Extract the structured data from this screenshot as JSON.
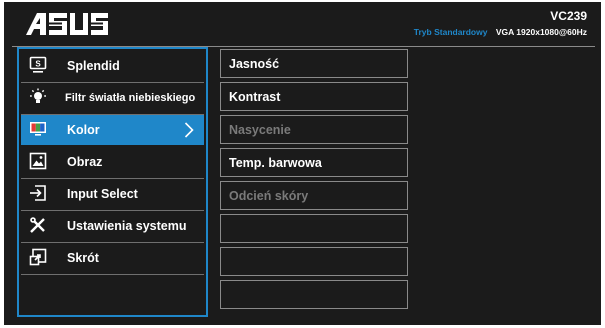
{
  "header": {
    "brand": "ASUS",
    "model": "VC239",
    "mode": "Tryb Standardowy",
    "signal": "VGA  1920x1080@60Hz"
  },
  "main_menu": [
    {
      "label": "Splendid",
      "icon": "splendid-icon",
      "active": false
    },
    {
      "label": "Filtr światła niebieskiego",
      "icon": "bluelight-bulb-icon",
      "active": false
    },
    {
      "label": "Kolor",
      "icon": "color-icon",
      "active": true
    },
    {
      "label": "Obraz",
      "icon": "image-icon",
      "active": false
    },
    {
      "label": "Input Select",
      "icon": "input-select-icon",
      "active": false
    },
    {
      "label": "Ustawienia systemu",
      "icon": "system-setup-icon",
      "active": false
    },
    {
      "label": "Skrót",
      "icon": "shortcut-icon",
      "active": false
    }
  ],
  "sub_menu": [
    {
      "label": "Jasność",
      "enabled": true
    },
    {
      "label": "Kontrast",
      "enabled": true
    },
    {
      "label": "Nasycenie",
      "enabled": false
    },
    {
      "label": "Temp. barwowa",
      "enabled": true
    },
    {
      "label": "Odcień skóry",
      "enabled": false
    },
    {
      "label": "",
      "enabled": true
    },
    {
      "label": "",
      "enabled": true
    },
    {
      "label": "",
      "enabled": true
    }
  ],
  "colors": {
    "accent": "#1f87c9",
    "background": "#1b1b1b",
    "disabled_text": "#7a7a7a"
  }
}
